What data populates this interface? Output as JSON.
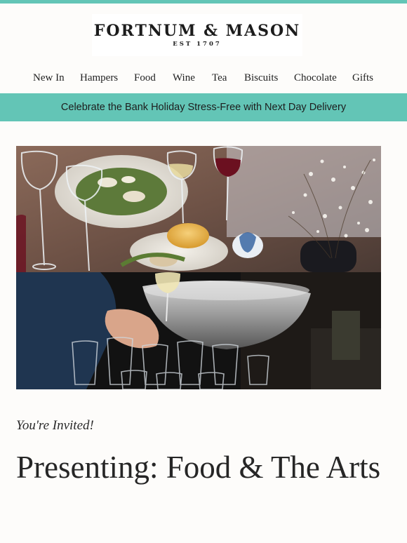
{
  "brand": {
    "name": "FORTNUM & MASON",
    "tagline": "EST 1707",
    "accent_color": "#63c5b6"
  },
  "nav": {
    "items": [
      {
        "label": "New In"
      },
      {
        "label": "Hampers"
      },
      {
        "label": "Food"
      },
      {
        "label": "Wine"
      },
      {
        "label": "Tea"
      },
      {
        "label": "Biscuits"
      },
      {
        "label": "Chocolate"
      },
      {
        "label": "Gifts"
      }
    ]
  },
  "banner": {
    "text": "Celebrate the Bank Holiday Stress-Free with Next Day Delivery"
  },
  "hero": {
    "top_image_icon": "dining-table-photo",
    "bottom_image_icon": "champagne-pouring-photo"
  },
  "content": {
    "eyebrow": "You're Invited!",
    "headline": "Presenting: Food & The Arts"
  }
}
